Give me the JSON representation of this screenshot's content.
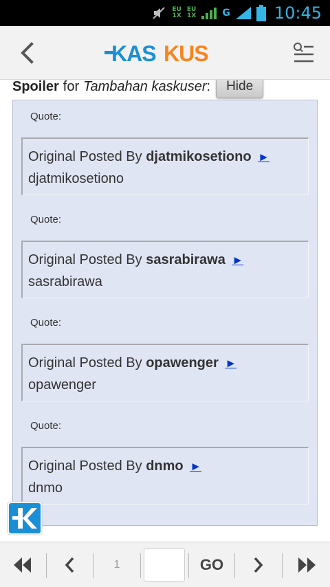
{
  "status_bar": {
    "network_top": "EU",
    "network_bottom": "1X",
    "network2_top": "EU",
    "network2_bottom": "1X",
    "signal_type": "G",
    "time": "10:45"
  },
  "app_bar": {
    "logo_text": "KASKUS",
    "logo_colors": {
      "blue": "#1a8fd6",
      "orange": "#f6851f"
    },
    "icons": [
      "back-arrow-icon",
      "search-menu-icon"
    ]
  },
  "spoiler": {
    "label": "Spoiler",
    "for_text": "for",
    "title": "Tambahan kaskuser",
    "colon": ":",
    "button_label": "Hide"
  },
  "quotes": [
    {
      "label": "Quote:",
      "prefix": "Original Posted By",
      "user": "djatmikosetiono",
      "arrow": "►",
      "body": "djatmikosetiono"
    },
    {
      "label": "Quote:",
      "prefix": "Original Posted By",
      "user": "sasrabirawa",
      "arrow": "►",
      "body": "sasrabirawa"
    },
    {
      "label": "Quote:",
      "prefix": "Original Posted By",
      "user": "opawenger",
      "arrow": "►",
      "body": "opawenger"
    },
    {
      "label": "Quote:",
      "prefix": "Original Posted By",
      "user": "dnmo",
      "arrow": "►",
      "body": "dnmo"
    }
  ],
  "bottom_nav": {
    "first_icon": "double-left-icon",
    "prev_icon": "chevron-left-icon",
    "current_page": "1",
    "page_input_value": "",
    "go_label": "GO",
    "next_icon": "chevron-right-icon",
    "last_icon": "double-right-icon"
  },
  "colors": {
    "status_time": "#33b5e5",
    "spoiler_bg": "#e0e5f3",
    "link_arrow": "#0033cc",
    "k_button": "#1a8fd6"
  }
}
